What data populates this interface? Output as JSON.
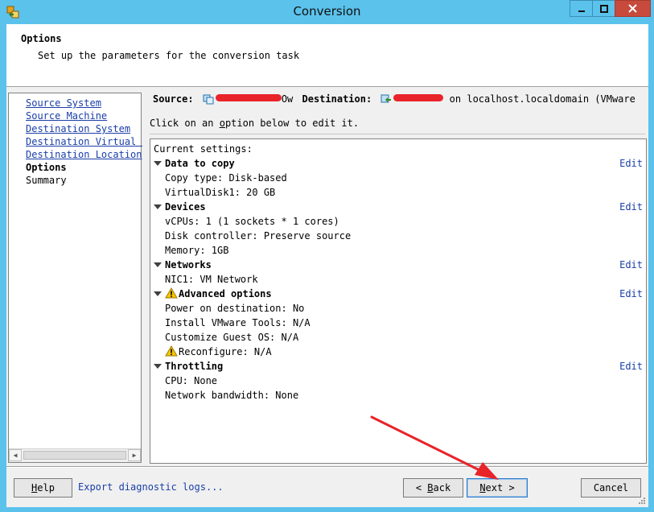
{
  "window": {
    "title": "Conversion"
  },
  "header": {
    "title": "Options",
    "subtitle": "Set up the parameters for the conversion task"
  },
  "nav": {
    "items": [
      {
        "label": "Source System",
        "state": "link"
      },
      {
        "label": "Source Machine",
        "state": "link"
      },
      {
        "label": "Destination System",
        "state": "link"
      },
      {
        "label": "Destination Virtual Machine",
        "state": "link"
      },
      {
        "label": "Destination Location",
        "state": "link"
      },
      {
        "label": "Options",
        "state": "current"
      },
      {
        "label": "Summary",
        "state": "plain"
      }
    ]
  },
  "summary_bar": {
    "source_label": "Source:",
    "source_suffix": "Ow",
    "destination_label": "Destination:",
    "destination_suffix": "on localhost.localdomain (VMware ..."
  },
  "hint": {
    "before": "Click on an ",
    "underlined": "o",
    "after": "ption below to edit it."
  },
  "settings": {
    "heading": "Current settings:",
    "edit_label": "Edit",
    "sections": [
      {
        "title": "Data to copy",
        "warning": false,
        "items": [
          {
            "text": "Copy type: Disk-based",
            "warning": false
          },
          {
            "text": "VirtualDisk1: 20 GB",
            "warning": false
          }
        ]
      },
      {
        "title": "Devices",
        "warning": false,
        "items": [
          {
            "text": "vCPUs: 1 (1 sockets * 1 cores)",
            "warning": false
          },
          {
            "text": "Disk controller: Preserve source",
            "warning": false
          },
          {
            "text": "Memory: 1GB",
            "warning": false
          }
        ]
      },
      {
        "title": "Networks",
        "warning": false,
        "items": [
          {
            "text": "NIC1: VM Network",
            "warning": false
          }
        ]
      },
      {
        "title": "Advanced options",
        "warning": true,
        "items": [
          {
            "text": "Power on destination: No",
            "warning": false
          },
          {
            "text": "Install VMware Tools: N/A",
            "warning": false
          },
          {
            "text": "Customize Guest OS: N/A",
            "warning": false
          },
          {
            "text": "Reconfigure: N/A",
            "warning": true
          }
        ]
      },
      {
        "title": "Throttling",
        "warning": false,
        "items": [
          {
            "text": "CPU: None",
            "warning": false
          },
          {
            "text": "Network bandwidth: None",
            "warning": false
          }
        ]
      }
    ]
  },
  "footer": {
    "help": {
      "mnemonic": "H",
      "rest": "elp"
    },
    "export_link": "Export diagnostic logs...",
    "back": {
      "prefix": "< ",
      "mnemonic": "B",
      "rest": "ack"
    },
    "next": {
      "mnemonic": "N",
      "rest": "ext >"
    },
    "cancel": "Cancel"
  },
  "colors": {
    "titlebar": "#5bc2ec",
    "link": "#1a3ea8",
    "close": "#c74a3c",
    "annotation_arrow": "#e8242a"
  }
}
